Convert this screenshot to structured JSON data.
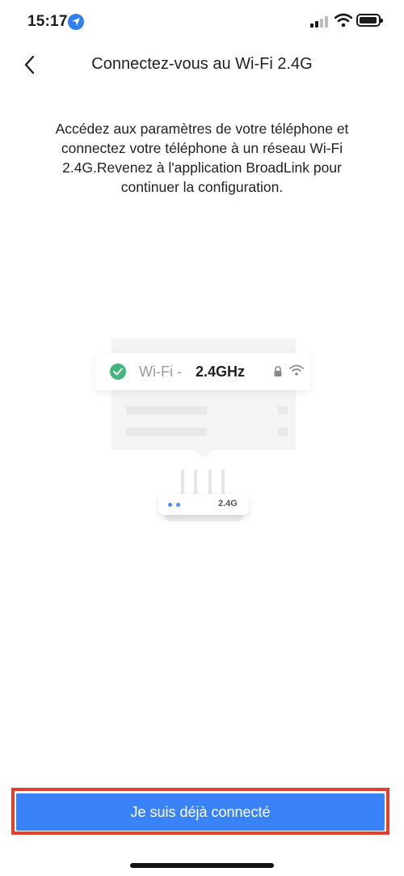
{
  "status_bar": {
    "time": "15:17",
    "icons": [
      "location-icon",
      "cellular-signal-icon",
      "wifi-icon",
      "battery-icon"
    ]
  },
  "header": {
    "title": "Connectez-vous au Wi-Fi 2.4G",
    "back_icon": "chevron-left-icon"
  },
  "instructions": "Accédez aux paramètres de votre téléphone et connectez votre téléphone à un réseau Wi-Fi 2.4G.Revenez à l'application BroadLink pour continuer la configuration.",
  "illustration": {
    "wifi_label": "Wi‑Fi -",
    "ssid": "2.4GHz",
    "router_label": "2.4G",
    "colors": {
      "check": "#43b77b",
      "led": "#4a8ef5"
    }
  },
  "footer": {
    "button_label": "Je suis déjà connecté",
    "button_color": "#3a82f7",
    "highlight_color": "#e53f2d"
  }
}
